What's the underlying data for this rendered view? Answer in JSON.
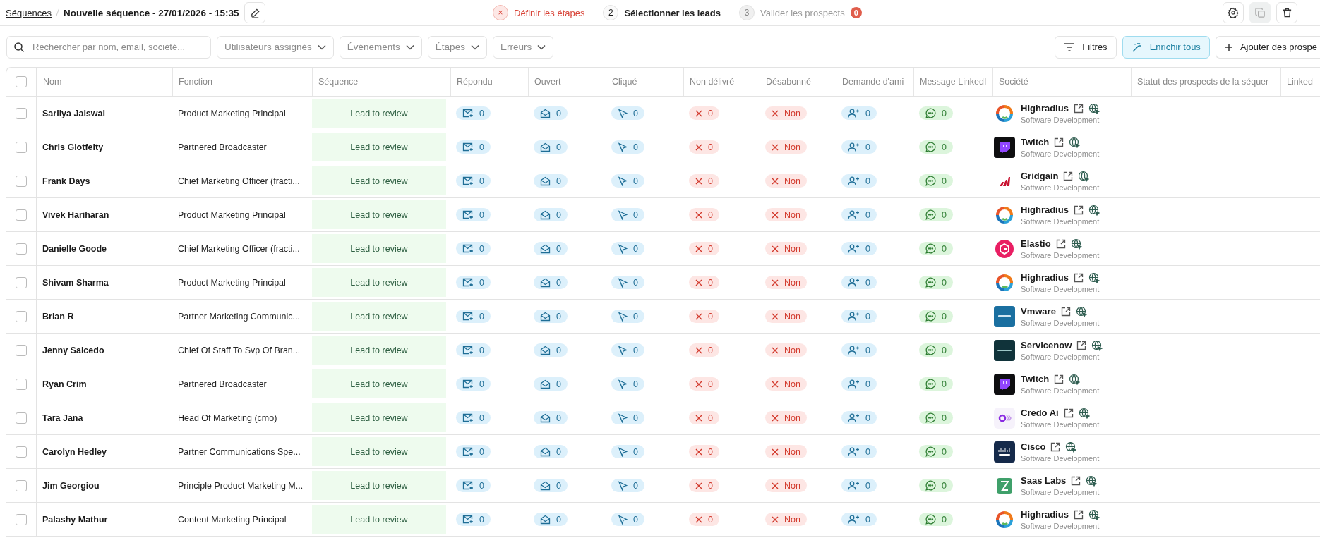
{
  "breadcrumb": {
    "parent": "Séquences",
    "title": "Nouvelle séquence - 27/01/2026 - 15:35"
  },
  "steps": [
    {
      "number": "×",
      "label": "Définir les étapes",
      "kind": "error"
    },
    {
      "number": "2",
      "label": "Sélectionner les leads",
      "kind": "active"
    },
    {
      "number": "3",
      "label": "Valider les prospects",
      "kind": "pending",
      "badge": "0"
    }
  ],
  "toolbar": {
    "search_placeholder": "Rechercher par nom, email, société...",
    "filters": [
      "Utilisateurs assignés",
      "Événements",
      "Étapes",
      "Erreurs"
    ],
    "buttons": [
      {
        "kind": "filter",
        "label": "Filtres"
      },
      {
        "kind": "enrich",
        "label": "Enrichir tous"
      },
      {
        "kind": "add",
        "label": "Ajouter des prospe"
      }
    ]
  },
  "table": {
    "header_checked": false,
    "columns": [
      "Nom",
      "Fonction",
      "Séquence",
      "Répondu",
      "Ouvert",
      "Cliqué",
      "Non délivré",
      "Désabonné",
      "Demande d'ami",
      "Message LinkedI",
      "Société",
      "Statut des prospects de la séquer",
      "Linked"
    ],
    "rows": [
      {
        "checked": false,
        "name": "Sarilya Jaiswal",
        "function": "Product Marketing Principal",
        "sequence": "Lead to review",
        "replied": "0",
        "opened": "0",
        "clicked": "0",
        "bounced": "0",
        "unsubscribed": "Non",
        "friend": "0",
        "message": "0",
        "company": "Highradius",
        "industry": "Software Development",
        "logo": {
          "kind": "ring"
        }
      },
      {
        "checked": false,
        "name": "Chris Glotfelty",
        "function": "Partnered Broadcaster",
        "sequence": "Lead to review",
        "replied": "0",
        "opened": "0",
        "clicked": "0",
        "bounced": "0",
        "unsubscribed": "Non",
        "friend": "0",
        "message": "0",
        "company": "Twitch",
        "industry": "Software Development",
        "logo": {
          "kind": "twitch"
        }
      },
      {
        "checked": false,
        "name": "Frank Days",
        "function": "Chief Marketing Officer (fracti...",
        "sequence": "Lead to review",
        "replied": "0",
        "opened": "0",
        "clicked": "0",
        "bounced": "0",
        "unsubscribed": "Non",
        "friend": "0",
        "message": "0",
        "company": "Gridgain",
        "industry": "Software Development",
        "logo": {
          "kind": "bars"
        }
      },
      {
        "checked": false,
        "name": "Vivek Hariharan",
        "function": "Product Marketing Principal",
        "sequence": "Lead to review",
        "replied": "0",
        "opened": "0",
        "clicked": "0",
        "bounced": "0",
        "unsubscribed": "Non",
        "friend": "0",
        "message": "0",
        "company": "Highradius",
        "industry": "Software Development",
        "logo": {
          "kind": "ring"
        }
      },
      {
        "checked": false,
        "name": "Danielle Goode",
        "function": "Chief Marketing Officer (fracti...",
        "sequence": "Lead to review",
        "replied": "0",
        "opened": "0",
        "clicked": "0",
        "bounced": "0",
        "unsubscribed": "Non",
        "friend": "0",
        "message": "0",
        "company": "Elastio",
        "industry": "Software Development",
        "logo": {
          "kind": "hexagon"
        }
      },
      {
        "checked": false,
        "name": "Shivam Sharma",
        "function": "Product Marketing Principal",
        "sequence": "Lead to review",
        "replied": "0",
        "opened": "0",
        "clicked": "0",
        "bounced": "0",
        "unsubscribed": "Non",
        "friend": "0",
        "message": "0",
        "company": "Highradius",
        "industry": "Software Development",
        "logo": {
          "kind": "ring"
        }
      },
      {
        "checked": false,
        "name": "Brian R",
        "function": "Partner Marketing Communic...",
        "sequence": "Lead to review",
        "replied": "0",
        "opened": "0",
        "clicked": "0",
        "bounced": "0",
        "unsubscribed": "Non",
        "friend": "0",
        "message": "0",
        "company": "Vmware",
        "industry": "Software Development",
        "logo": {
          "kind": "blue"
        }
      },
      {
        "checked": false,
        "name": "Jenny Salcedo",
        "function": "Chief Of Staff To Svp Of Bran...",
        "sequence": "Lead to review",
        "replied": "0",
        "opened": "0",
        "clicked": "0",
        "bounced": "0",
        "unsubscribed": "Non",
        "friend": "0",
        "message": "0",
        "company": "Servicenow",
        "industry": "Software Development",
        "logo": {
          "kind": "dark"
        }
      },
      {
        "checked": false,
        "name": "Ryan Crim",
        "function": "Partnered Broadcaster",
        "sequence": "Lead to review",
        "replied": "0",
        "opened": "0",
        "clicked": "0",
        "bounced": "0",
        "unsubscribed": "Non",
        "friend": "0",
        "message": "0",
        "company": "Twitch",
        "industry": "Software Development",
        "logo": {
          "kind": "twitch"
        }
      },
      {
        "checked": false,
        "name": "Tara Jana",
        "function": "Head Of Marketing (cmo)",
        "sequence": "Lead to review",
        "replied": "0",
        "opened": "0",
        "clicked": "0",
        "bounced": "0",
        "unsubscribed": "Non",
        "friend": "0",
        "message": "0",
        "company": "Credo Ai",
        "industry": "Software Development",
        "logo": {
          "kind": "waves"
        }
      },
      {
        "checked": false,
        "name": "Carolyn Hedley",
        "function": "Partner Communications Spe...",
        "sequence": "Lead to review",
        "replied": "0",
        "opened": "0",
        "clicked": "0",
        "bounced": "0",
        "unsubscribed": "Non",
        "friend": "0",
        "message": "0",
        "company": "Cisco",
        "industry": "Software Development",
        "logo": {
          "kind": "navy"
        }
      },
      {
        "checked": false,
        "name": "Jim Georgiou",
        "function": "Principle Product Marketing M...",
        "sequence": "Lead to review",
        "replied": "0",
        "opened": "0",
        "clicked": "0",
        "bounced": "0",
        "unsubscribed": "Non",
        "friend": "0",
        "message": "0",
        "company": "Saas Labs",
        "industry": "Software Development",
        "logo": {
          "kind": "hourglass"
        }
      },
      {
        "checked": false,
        "name": "Palashy Mathur",
        "function": "Content Marketing Principal",
        "sequence": "Lead to review",
        "replied": "0",
        "opened": "0",
        "clicked": "0",
        "bounced": "0",
        "unsubscribed": "Non",
        "friend": "0",
        "message": "0",
        "company": "Highradius",
        "industry": "Software Development",
        "logo": {
          "kind": "ring"
        }
      }
    ]
  }
}
